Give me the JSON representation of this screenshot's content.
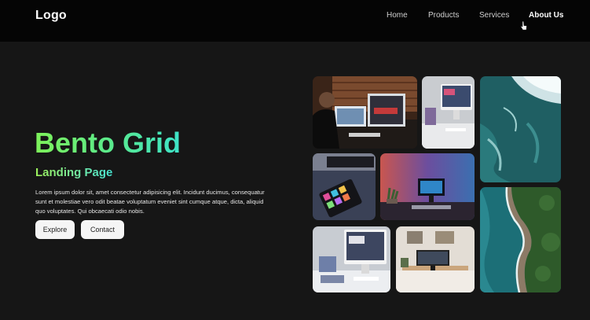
{
  "header": {
    "logo": "Logo",
    "nav": [
      "Home",
      "Products",
      "Services",
      "About Us"
    ],
    "active_nav": "About Us"
  },
  "hero": {
    "title": "Bento Grid",
    "subtitle": "Landing Page",
    "description": "Lorem ipsum dolor sit, amet consectetur adipisicing elit. Incidunt ducimus, consequatur sunt et molestiae vero odit beatae voluptatum eveniet sint cumque atque, dicta, aliquid quo voluptates. Qui obcaecati odio nobis.",
    "buttons": {
      "explore": "Explore",
      "contact": "Contact"
    }
  },
  "colors": {
    "background": "#161616",
    "header": "#050505",
    "title_gradient_start": "#7ef25a",
    "title_gradient_end": "#3ee3c9",
    "button_bg": "#f5f5f5"
  },
  "icons": [
    "mouse-pointer-icon"
  ]
}
